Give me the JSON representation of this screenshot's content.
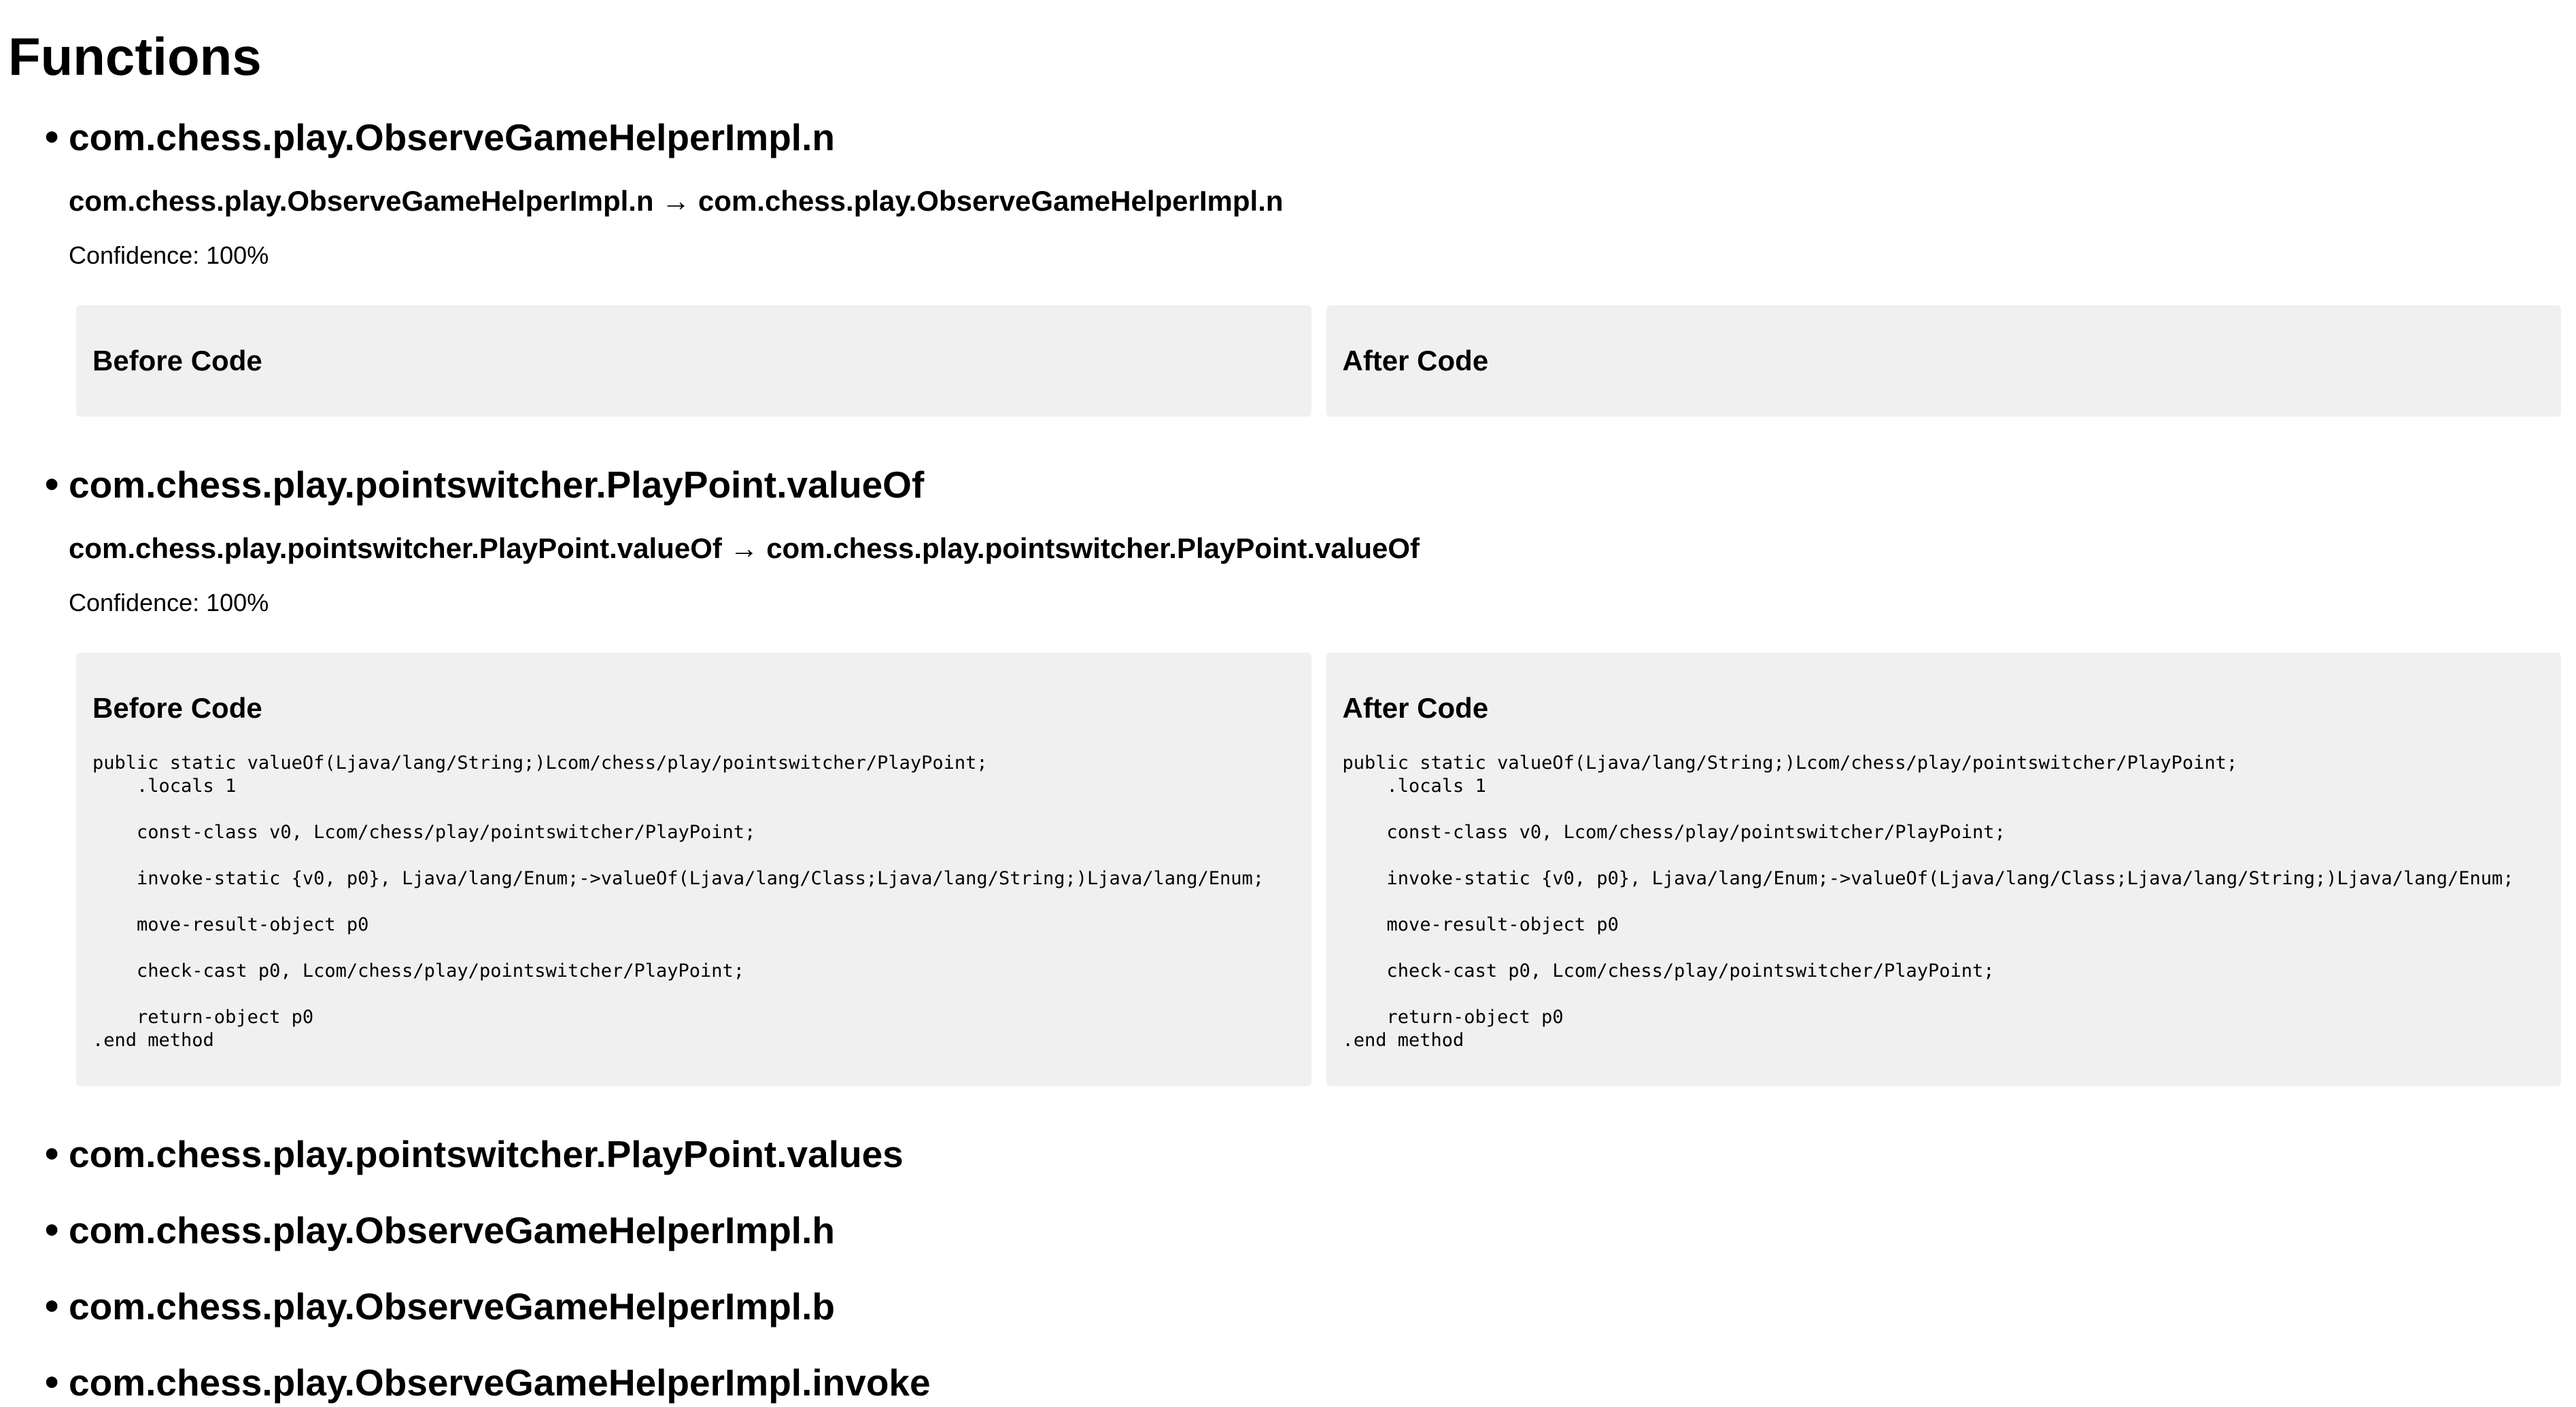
{
  "page_title": "Functions",
  "functions": [
    {
      "name": "com.chess.play.ObserveGameHelperImpl.n",
      "mapping": "com.chess.play.ObserveGameHelperImpl.n → com.chess.play.ObserveGameHelperImpl.n",
      "confidence": "Confidence: 100%",
      "before_title": "Before Code",
      "after_title": "After Code",
      "before_code": "",
      "after_code": ""
    },
    {
      "name": "com.chess.play.pointswitcher.PlayPoint.valueOf",
      "mapping": "com.chess.play.pointswitcher.PlayPoint.valueOf → com.chess.play.pointswitcher.PlayPoint.valueOf",
      "confidence": "Confidence: 100%",
      "before_title": "Before Code",
      "after_title": "After Code",
      "before_code": "public static valueOf(Ljava/lang/String;)Lcom/chess/play/pointswitcher/PlayPoint;\n    .locals 1\n\n    const-class v0, Lcom/chess/play/pointswitcher/PlayPoint;\n\n    invoke-static {v0, p0}, Ljava/lang/Enum;->valueOf(Ljava/lang/Class;Ljava/lang/String;)Ljava/lang/Enum;\n\n    move-result-object p0\n\n    check-cast p0, Lcom/chess/play/pointswitcher/PlayPoint;\n\n    return-object p0\n.end method",
      "after_code": "public static valueOf(Ljava/lang/String;)Lcom/chess/play/pointswitcher/PlayPoint;\n    .locals 1\n\n    const-class v0, Lcom/chess/play/pointswitcher/PlayPoint;\n\n    invoke-static {v0, p0}, Ljava/lang/Enum;->valueOf(Ljava/lang/Class;Ljava/lang/String;)Ljava/lang/Enum;\n\n    move-result-object p0\n\n    check-cast p0, Lcom/chess/play/pointswitcher/PlayPoint;\n\n    return-object p0\n.end method"
    },
    {
      "name": "com.chess.play.pointswitcher.PlayPoint.values"
    },
    {
      "name": "com.chess.play.ObserveGameHelperImpl.h"
    },
    {
      "name": "com.chess.play.ObserveGameHelperImpl.b"
    },
    {
      "name": "com.chess.play.ObserveGameHelperImpl.invoke"
    }
  ]
}
